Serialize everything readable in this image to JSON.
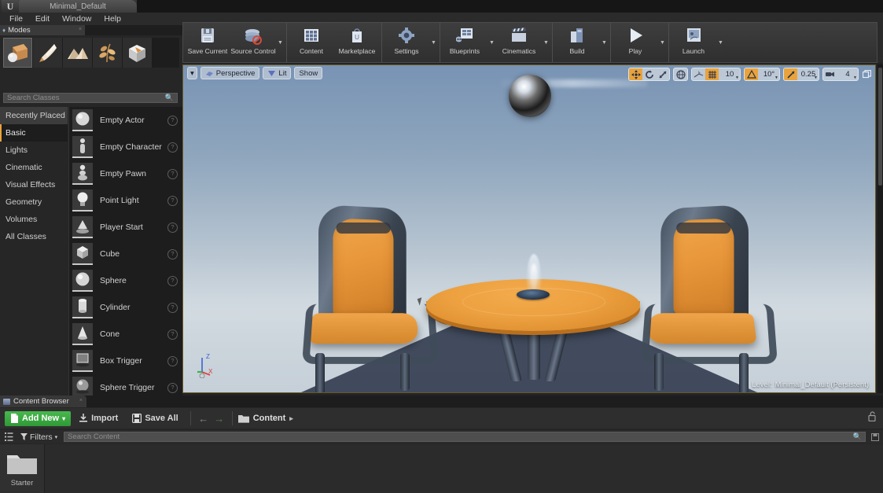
{
  "titlebar": {
    "project_tab": "Minimal_Default",
    "logo": "unreal-logo"
  },
  "menubar": {
    "items": [
      "File",
      "Edit",
      "Window",
      "Help"
    ]
  },
  "modes_panel": {
    "tab_label": "Modes",
    "tab_icon": "modes-icon",
    "close_label": "×",
    "mode_buttons": [
      {
        "name": "place-mode",
        "icon": "place-actor-icon",
        "selected": true
      },
      {
        "name": "paint-mode",
        "icon": "paint-brush-icon",
        "selected": false
      },
      {
        "name": "landscape-mode",
        "icon": "landscape-icon",
        "selected": false
      },
      {
        "name": "foliage-mode",
        "icon": "foliage-leaf-icon",
        "selected": false
      },
      {
        "name": "geometry-editing-mode",
        "icon": "geometry-box-icon",
        "selected": false
      }
    ],
    "search": {
      "placeholder": "Search Classes",
      "value": "",
      "icon": "search-icon"
    },
    "categories": [
      {
        "label": "Recently Placed",
        "state": "hover"
      },
      {
        "label": "Basic",
        "state": "selected"
      },
      {
        "label": "Lights",
        "state": "normal"
      },
      {
        "label": "Cinematic",
        "state": "normal"
      },
      {
        "label": "Visual Effects",
        "state": "normal"
      },
      {
        "label": "Geometry",
        "state": "normal"
      },
      {
        "label": "Volumes",
        "state": "normal"
      },
      {
        "label": "All Classes",
        "state": "normal"
      }
    ],
    "classes": [
      {
        "label": "Empty Actor",
        "icon": "sphere-thumb",
        "help": "?"
      },
      {
        "label": "Empty Character",
        "icon": "character-thumb",
        "help": "?"
      },
      {
        "label": "Empty Pawn",
        "icon": "pawn-thumb",
        "help": "?"
      },
      {
        "label": "Point Light",
        "icon": "bulb-thumb",
        "help": "?"
      },
      {
        "label": "Player Start",
        "icon": "playerstart-thumb",
        "help": "?"
      },
      {
        "label": "Cube",
        "icon": "cube-thumb",
        "help": "?"
      },
      {
        "label": "Sphere",
        "icon": "sphere-thumb",
        "help": "?"
      },
      {
        "label": "Cylinder",
        "icon": "cylinder-thumb",
        "help": "?"
      },
      {
        "label": "Cone",
        "icon": "cone-thumb",
        "help": "?"
      },
      {
        "label": "Box Trigger",
        "icon": "box-trigger-thumb",
        "help": "?"
      },
      {
        "label": "Sphere Trigger",
        "icon": "sphere-trigger-thumb",
        "help": "?"
      }
    ]
  },
  "toolbar": {
    "groups": [
      {
        "buttons": [
          {
            "label": "Save Current",
            "icon": "save-disk-icon",
            "dropdown": false
          },
          {
            "label": "Source Control",
            "icon": "source-control-icon",
            "dropdown": true
          }
        ]
      },
      {
        "buttons": [
          {
            "label": "Content",
            "icon": "content-grid-icon",
            "dropdown": false
          },
          {
            "label": "Marketplace",
            "icon": "marketplace-bag-icon",
            "dropdown": false
          }
        ]
      },
      {
        "buttons": [
          {
            "label": "Settings",
            "icon": "settings-gear-icon",
            "dropdown": true
          }
        ]
      },
      {
        "buttons": [
          {
            "label": "Blueprints",
            "icon": "blueprints-icon",
            "dropdown": true
          },
          {
            "label": "Cinematics",
            "icon": "cinematics-clapper-icon",
            "dropdown": true
          }
        ]
      },
      {
        "buttons": [
          {
            "label": "Build",
            "icon": "build-icon",
            "dropdown": true
          }
        ]
      },
      {
        "buttons": [
          {
            "label": "Play",
            "icon": "play-triangle-icon",
            "dropdown": true
          }
        ]
      },
      {
        "buttons": [
          {
            "label": "Launch",
            "icon": "launch-icon",
            "dropdown": true
          }
        ]
      }
    ]
  },
  "viewport": {
    "left_controls": {
      "menu_arrow": "▾",
      "camera_mode": {
        "label": "Perspective",
        "icon": "camera-icon"
      },
      "view_mode": {
        "label": "Lit",
        "icon": "lit-icon"
      },
      "show_menu": {
        "label": "Show"
      }
    },
    "right_controls": {
      "transform": [
        {
          "name": "translate-mode",
          "icon": "move-gizmo-icon",
          "active": true
        },
        {
          "name": "rotate-mode",
          "icon": "rotate-gizmo-icon",
          "active": false
        },
        {
          "name": "scale-mode",
          "icon": "scale-gizmo-icon",
          "active": false
        }
      ],
      "coordinate_system": {
        "name": "world-coordinate-toggle",
        "icon": "globe-icon",
        "active": false
      },
      "surface_snap": {
        "name": "surface-snap-toggle",
        "icon": "surface-snap-icon",
        "active": false
      },
      "grid_snap": {
        "name": "grid-snap-toggle",
        "icon": "grid-icon",
        "active": true,
        "value": "10"
      },
      "rotation_snap": {
        "name": "rotation-snap-toggle",
        "icon": "angle-icon",
        "active": true,
        "value": "10°"
      },
      "scale_snap": {
        "name": "scale-snap-toggle",
        "icon": "scale-snap-icon",
        "active": true,
        "value": "0.25"
      },
      "camera_speed": {
        "name": "camera-speed",
        "icon": "camera-speed-icon",
        "value": "4"
      },
      "maximize": {
        "name": "maximize-viewport",
        "icon": "maximize-icon"
      }
    },
    "gizmo_axes": [
      {
        "label": "Z",
        "color": "#3c62d6"
      },
      {
        "label": "X",
        "color": "#d63c3c"
      },
      {
        "label": "Y",
        "color": "#3cb44a"
      }
    ],
    "level_status": {
      "key": "Level:",
      "value": "Minimal_Default (Persistent)"
    },
    "scene": {
      "description": "Two orange chairs around a round orange table with a blue candle on a dark platform",
      "sky_color": "#8fa6bd",
      "platform_color": "#3b4557",
      "table_color": "#eda03f",
      "chair_frame_color": "#4b5866",
      "chair_cushion_color": "#e8963a"
    }
  },
  "content_browser": {
    "tab_label": "Content Browser",
    "tab_icon": "content-browser-icon",
    "close_label": "×",
    "toolbar": {
      "add_new": {
        "label": "Add New",
        "icon": "add-new-icon",
        "arrow": "▾",
        "color": "#3f9e43"
      },
      "import": {
        "label": "Import",
        "icon": "import-icon"
      },
      "save_all": {
        "label": "Save All",
        "icon": "save-all-icon"
      },
      "back": {
        "name": "back-nav",
        "icon": "arrow-left-icon",
        "glyph": "←"
      },
      "forward": {
        "name": "forward-nav",
        "icon": "arrow-right-icon",
        "glyph": "→"
      },
      "breadcrumb": {
        "folder_icon": "folder-icon",
        "path": "Content",
        "arrow": "▸"
      }
    },
    "filter_row": {
      "sources_icon": "sources-panel-icon",
      "filters": {
        "label": "Filters",
        "icon": "filter-funnel-icon",
        "arrow": "▾"
      },
      "search": {
        "placeholder": "Search Content",
        "value": "",
        "icon": "search-icon"
      },
      "lock_icon": "lock-open-icon",
      "save_search_icon": "save-search-icon"
    },
    "assets": [
      {
        "label": "Starter",
        "type": "folder",
        "icon": "folder-icon"
      }
    ]
  }
}
